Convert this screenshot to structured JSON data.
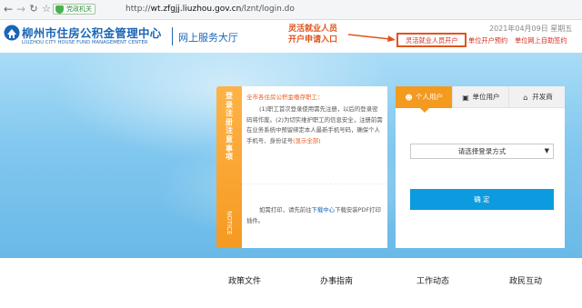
{
  "browser": {
    "back_icon": "arrow-left-icon",
    "forward_icon": "arrow-right-icon",
    "refresh_icon": "refresh-icon",
    "bookmark_icon": "star-icon",
    "security_badge": "党政机关",
    "url_scheme": "http://",
    "url_host": "wt.zfgjj.liuzhou.gov.cn",
    "url_path": "/lznt/login.do"
  },
  "header": {
    "logo_text_cn": "柳州市住房公积金管理中心",
    "logo_text_en": "LIUZHOU CITY HOUSE FUND MANAGEMENT CENTER",
    "service_hall": "网上服务大厅",
    "annotation_line1": "灵活就业人员",
    "annotation_line2": "开户申请入口",
    "date": "2021年04月09日  星期五",
    "links": [
      "灵活就业人员开户",
      "单位开户预约",
      "单位网上自助签约"
    ],
    "accent_color": "#e2531c",
    "brand_color": "#1a66b5"
  },
  "notice": {
    "tab_title": "登录注册注意事项",
    "tab_title_en": "NOTICE",
    "greeting": "全市各住房公积金缴存职工：",
    "body_prefix": "(1)职工首次登录使用需先注册，以后的登录密码将作废。(2)为切实维护职工的信息安全，注册前需在业务系统中预留绑定本人最新手机号码，确保个人手机号、身份证号",
    "show_all": "(显示全部)",
    "download_prefix": "如需打印，请先前往",
    "download_link": "下载中心",
    "download_suffix": "下载安装PDF打印插件。"
  },
  "login": {
    "tabs": [
      {
        "label": "个人用户",
        "icon": "user-icon"
      },
      {
        "label": "单位用户",
        "icon": "building-icon"
      },
      {
        "label": "开发商",
        "icon": "house-icon"
      }
    ],
    "select_placeholder": "请选择登录方式",
    "submit_label": "确 定"
  },
  "bottom_nav": [
    "政策文件",
    "办事指南",
    "工作动态",
    "政民互动"
  ]
}
